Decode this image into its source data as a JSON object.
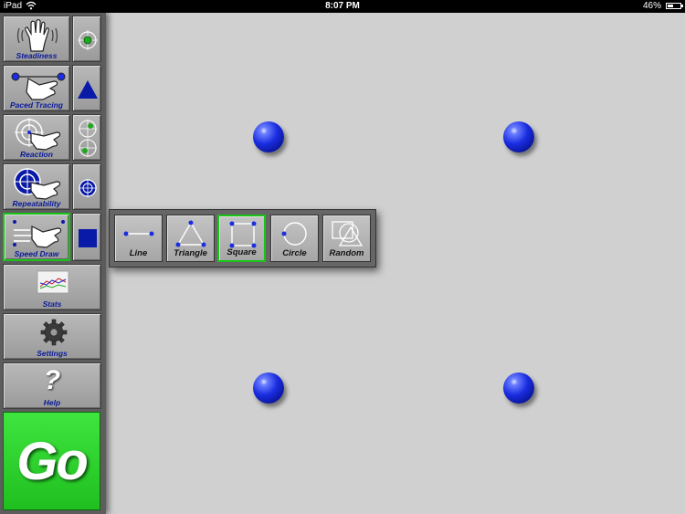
{
  "status_bar": {
    "carrier": "iPad",
    "time": "8:07 PM",
    "battery": "46%",
    "battery_level": 0.46
  },
  "sidebar": {
    "tests": [
      {
        "label": "Steadiness",
        "icon": "hand-vibration-icon",
        "option_icon": "green-target-dot-icon"
      },
      {
        "label": "Paced Tracing",
        "icon": "hand-tracing-icon",
        "option_icon": "blue-triangle-icon"
      },
      {
        "label": "Reaction",
        "icon": "hand-target-icon",
        "option_icon": "double-target-icon"
      },
      {
        "label": "Repeatability",
        "icon": "hand-blue-target-icon",
        "option_icon": "blue-target-icon"
      },
      {
        "label": "Speed Draw",
        "icon": "hand-speed-icon",
        "option_icon": "blue-square-icon"
      }
    ],
    "stats_label": "Stats",
    "settings_label": "Settings",
    "help_label": "Help",
    "help_glyph": "?",
    "go_label": "Go",
    "selected_test": "Speed Draw"
  },
  "shape_menu": {
    "items": [
      {
        "label": "Line",
        "icon": "line-icon"
      },
      {
        "label": "Triangle",
        "icon": "triangle-icon"
      },
      {
        "label": "Square",
        "icon": "square-icon"
      },
      {
        "label": "Circle",
        "icon": "circle-icon"
      },
      {
        "label": "Random",
        "icon": "random-shapes-icon"
      }
    ],
    "selected": "Square"
  },
  "canvas": {
    "target_count": 4
  },
  "colors": {
    "select_green": "#18c418",
    "label_blue": "#0a1a9a",
    "go_green": "#2fd42f",
    "target_blue": "#1a2de0"
  }
}
